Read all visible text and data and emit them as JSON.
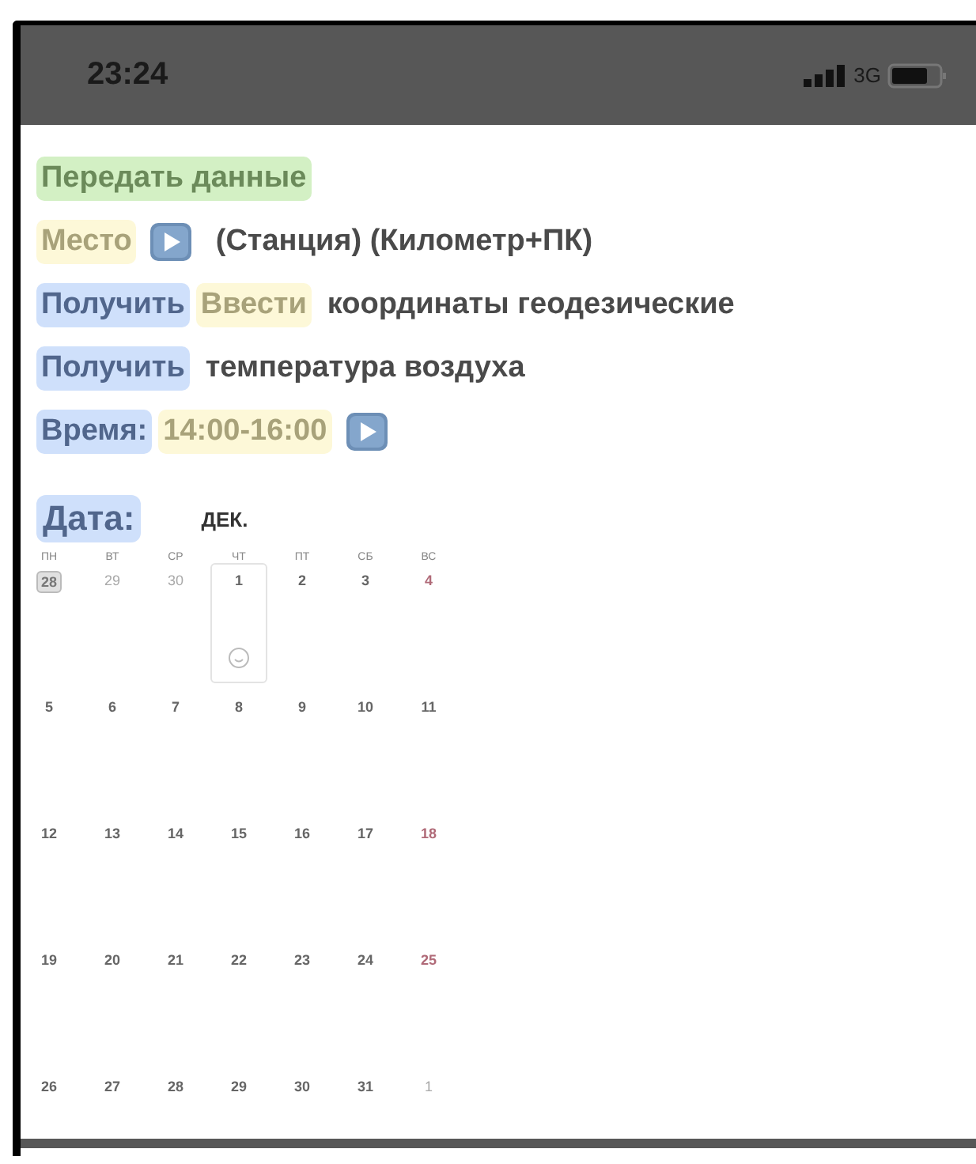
{
  "status_bar": {
    "time": "23:24",
    "network": "3G"
  },
  "lines": [
    {
      "segments": [
        {
          "kind": "chip",
          "text": "Передать данные",
          "color": "#d3f0c4"
        }
      ]
    },
    {
      "segments": [
        {
          "kind": "chip",
          "text": "Место",
          "color": "#fdf8d8"
        },
        {
          "kind": "play"
        },
        {
          "kind": "text",
          "text": "(Станция) (Километр+ПК)"
        }
      ]
    },
    {
      "segments": [
        {
          "kind": "chip",
          "text": "Получить",
          "color": "#cfe0fb"
        },
        {
          "kind": "chip",
          "text": "Ввести",
          "color": "#fdf8d8"
        },
        {
          "kind": "text",
          "text": "координаты геодезические"
        }
      ]
    },
    {
      "segments": [
        {
          "kind": "chip",
          "text": "Получить",
          "color": "#cfe0fb"
        },
        {
          "kind": "text",
          "text": "температура воздуха"
        }
      ]
    },
    {
      "segments": [
        {
          "kind": "chip",
          "text": "Время:",
          "color": "#cfe0fb"
        },
        {
          "kind": "chip",
          "text": "14:00-16:00",
          "color": "#fdf8d8"
        },
        {
          "kind": "play"
        }
      ]
    }
  ],
  "calendar": {
    "label": "Дата:",
    "month": "ДЕК.",
    "weekdays": [
      "ПН",
      "ВТ",
      "СР",
      "ЧТ",
      "ПТ",
      "СБ",
      "ВС"
    ],
    "weeks": [
      [
        {
          "label": "28",
          "kind": "today",
          "selected": false
        },
        {
          "label": "29",
          "kind": "outside",
          "selected": false
        },
        {
          "label": "30",
          "kind": "outside",
          "selected": false
        },
        {
          "label": "1",
          "kind": "normal",
          "selected": true
        },
        {
          "label": "2",
          "kind": "normal",
          "selected": false
        },
        {
          "label": "3",
          "kind": "normal",
          "selected": false
        },
        {
          "label": "4",
          "kind": "holiday",
          "selected": false
        }
      ],
      [
        {
          "label": "5",
          "kind": "normal",
          "selected": false
        },
        {
          "label": "6",
          "kind": "normal",
          "selected": false
        },
        {
          "label": "7",
          "kind": "normal",
          "selected": false
        },
        {
          "label": "8",
          "kind": "normal",
          "selected": false
        },
        {
          "label": "9",
          "kind": "normal",
          "selected": false
        },
        {
          "label": "10",
          "kind": "normal",
          "selected": false
        },
        {
          "label": "11",
          "kind": "normal",
          "selected": false
        }
      ],
      [
        {
          "label": "12",
          "kind": "normal",
          "selected": false
        },
        {
          "label": "13",
          "kind": "normal",
          "selected": false
        },
        {
          "label": "14",
          "kind": "normal",
          "selected": false
        },
        {
          "label": "15",
          "kind": "normal",
          "selected": false
        },
        {
          "label": "16",
          "kind": "normal",
          "selected": false
        },
        {
          "label": "17",
          "kind": "normal",
          "selected": false
        },
        {
          "label": "18",
          "kind": "holiday",
          "selected": false
        }
      ],
      [
        {
          "label": "19",
          "kind": "normal",
          "selected": false
        },
        {
          "label": "20",
          "kind": "normal",
          "selected": false
        },
        {
          "label": "21",
          "kind": "normal",
          "selected": false
        },
        {
          "label": "22",
          "kind": "normal",
          "selected": false
        },
        {
          "label": "23",
          "kind": "normal",
          "selected": false
        },
        {
          "label": "24",
          "kind": "normal",
          "selected": false
        },
        {
          "label": "25",
          "kind": "holiday",
          "selected": false
        }
      ],
      [
        {
          "label": "26",
          "kind": "normal",
          "selected": false
        },
        {
          "label": "27",
          "kind": "normal",
          "selected": false
        },
        {
          "label": "28",
          "kind": "normal",
          "selected": false
        },
        {
          "label": "29",
          "kind": "normal",
          "selected": false
        },
        {
          "label": "30",
          "kind": "normal",
          "selected": false
        },
        {
          "label": "31",
          "kind": "normal",
          "selected": false
        },
        {
          "label": "1",
          "kind": "outside",
          "selected": false
        }
      ]
    ]
  }
}
